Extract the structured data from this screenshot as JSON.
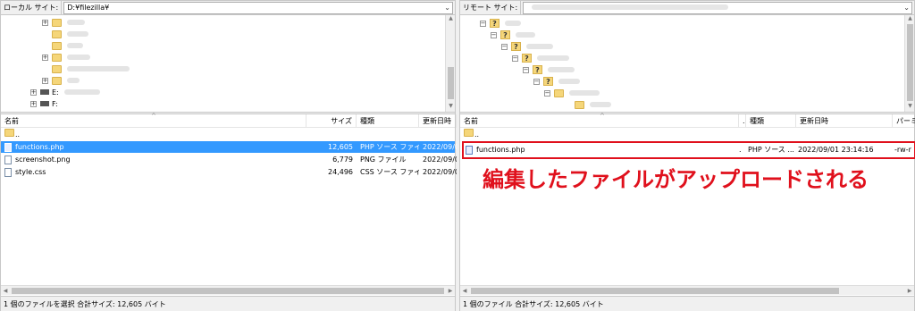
{
  "local": {
    "site_label": "ローカル サイト:",
    "path": "D:¥filezilla¥",
    "tree": {
      "drive_e": "E:",
      "drive_f": "F:"
    },
    "columns": {
      "name": "名前",
      "size": "サイズ",
      "type": "種類",
      "modified": "更新日時"
    },
    "parent_row": "..",
    "files": [
      {
        "name": "functions.php",
        "size": "12,605",
        "type": "PHP ソース ファイ...",
        "modified": "2022/09/0",
        "icon": "php-file-icon"
      },
      {
        "name": "screenshot.png",
        "size": "6,779",
        "type": "PNG ファイル",
        "modified": "2022/09/0",
        "icon": "image-file-icon"
      },
      {
        "name": "style.css",
        "size": "24,496",
        "type": "CSS ソース ファイル",
        "modified": "2022/09/0",
        "icon": "css-file-icon"
      }
    ],
    "status": "1 個のファイルを選択 合計サイズ: 12,605 バイト"
  },
  "remote": {
    "site_label": "リモート サイト:",
    "columns": {
      "name": "名前",
      "size": ".",
      "type": "種類",
      "modified": "更新日時",
      "perms": "パーミッ"
    },
    "parent_row": "..",
    "files": [
      {
        "name": "functions.php",
        "size": ".",
        "type": "PHP ソース ...",
        "modified": "2022/09/01 23:14:16",
        "perms": "-rw-r",
        "icon": "php-file-icon"
      }
    ],
    "status": "1 個のファイル 合計サイズ: 12,605 バイト"
  },
  "annotation": "編集したファイルがアップロードされる",
  "colors": {
    "selection": "#3399ff",
    "annotation": "#e0101c",
    "folder": "#f5d67a"
  }
}
